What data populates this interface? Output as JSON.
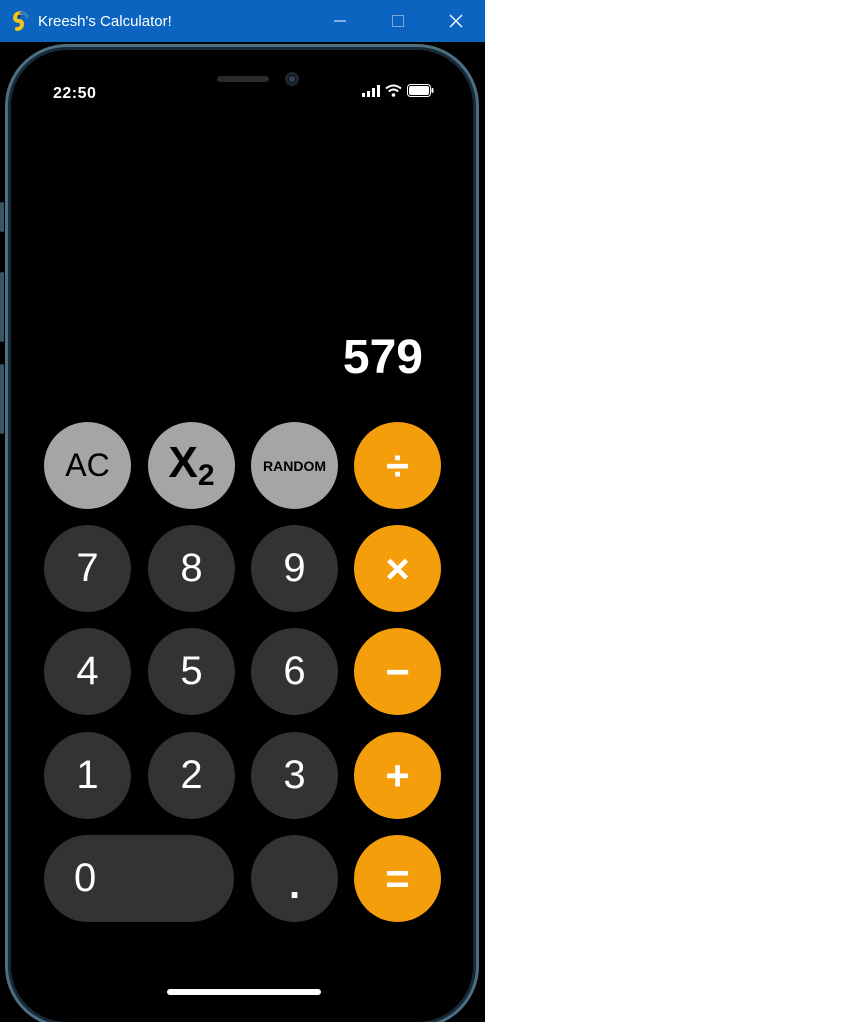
{
  "window": {
    "title": "Kreesh's Calculator!"
  },
  "status_bar": {
    "time": "22:50"
  },
  "display": {
    "value": "579"
  },
  "keys": {
    "ac": "AC",
    "x2_base": "X",
    "x2_sub": "2",
    "random": "RANDOM",
    "divide": "÷",
    "seven": "7",
    "eight": "8",
    "nine": "9",
    "multiply": "×",
    "four": "4",
    "five": "5",
    "six": "6",
    "minus": "−",
    "one": "1",
    "two": "2",
    "three": "3",
    "plus": "+",
    "zero": "0",
    "decimal": ".",
    "equals": "="
  },
  "colors": {
    "titlebar": "#0a64c0",
    "function_key": "#a5a5a5",
    "digit_key": "#333333",
    "operator_key": "#f59e0b",
    "background": "#000000"
  },
  "icons": {
    "app": "pygame-snake-icon",
    "minimize": "minimize-icon",
    "maximize": "maximize-icon",
    "close": "close-icon",
    "signal": "cellular-signal-icon",
    "wifi": "wifi-icon",
    "battery": "battery-icon"
  }
}
